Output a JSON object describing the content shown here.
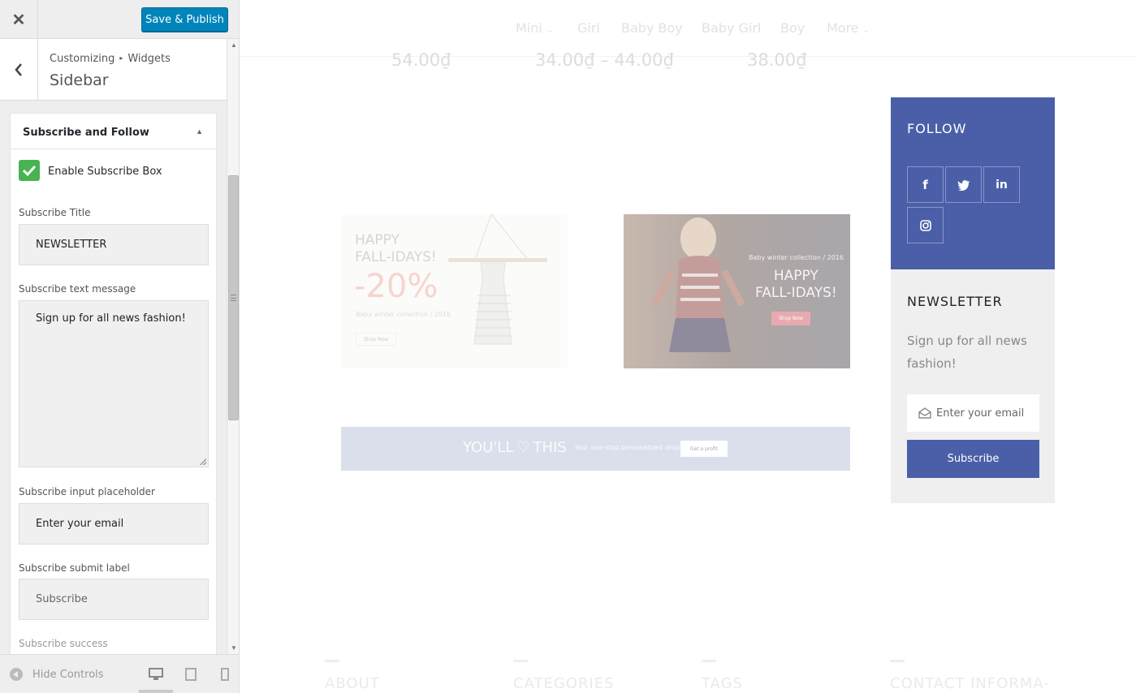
{
  "header": {
    "close_glyph": "✕",
    "publish_label": "Save & Publish"
  },
  "section": {
    "breadcrumb_parent": "Customizing",
    "breadcrumb_child": "Widgets",
    "title": "Sidebar"
  },
  "widget": {
    "title": "Subscribe and Follow",
    "enable_label": "Enable Subscribe Box",
    "enable_checked": true,
    "fields": {
      "title_label": "Subscribe Title",
      "title_value": "NEWSLETTER",
      "message_label": "Subscribe text message",
      "message_value": "Sign up for all news fashion!",
      "placeholder_label": "Subscribe input placeholder",
      "placeholder_value": "Enter your email",
      "submit_label": "Subscribe submit label",
      "submit_value": "Subscribe",
      "success_label": "Subscribe success"
    }
  },
  "footer": {
    "hide_controls": "Hide Controls",
    "devices": [
      "desktop-icon",
      "tablet-icon",
      "mobile-icon"
    ]
  },
  "preview": {
    "nav": [
      "Mini",
      "Girl",
      "Baby Boy",
      "Baby Girl",
      "Boy",
      "More"
    ],
    "prices": [
      "54.00₫",
      "34.00₫ – 44.00₫",
      "38.00₫"
    ],
    "banner1": {
      "line1": "HAPPY",
      "line2": "FALL-IDAYS!",
      "discount": "-20%",
      "caption": "Baby winter collection / 2016",
      "button": "Shop Now"
    },
    "banner2": {
      "caption": "Baby winter collection / 2016",
      "line1": "HAPPY",
      "line2": "FALL-IDAYS!",
      "button": "Shop Now"
    },
    "banner3": {
      "headline_a": "YOU'LL",
      "headline_b": "THIS",
      "tagline": "Your one-stop personalized shop!",
      "button": "Get a profit"
    },
    "follow": {
      "title": "FOLLOW",
      "socials": [
        "f",
        "🐦",
        "in",
        "◎"
      ]
    },
    "newsletter": {
      "title": "NEWSLETTER",
      "text": "Sign up for all news fashion!",
      "placeholder": "Enter your email",
      "button": "Subscribe"
    },
    "footer_cols": [
      "ABOUT",
      "CATEGORIES",
      "TAGS",
      "CONTACT INFORMA-"
    ]
  },
  "colors": {
    "primary_button": "#0085ba",
    "checkbox_green": "#46b450",
    "brand_blue": "#4a5fa8"
  }
}
